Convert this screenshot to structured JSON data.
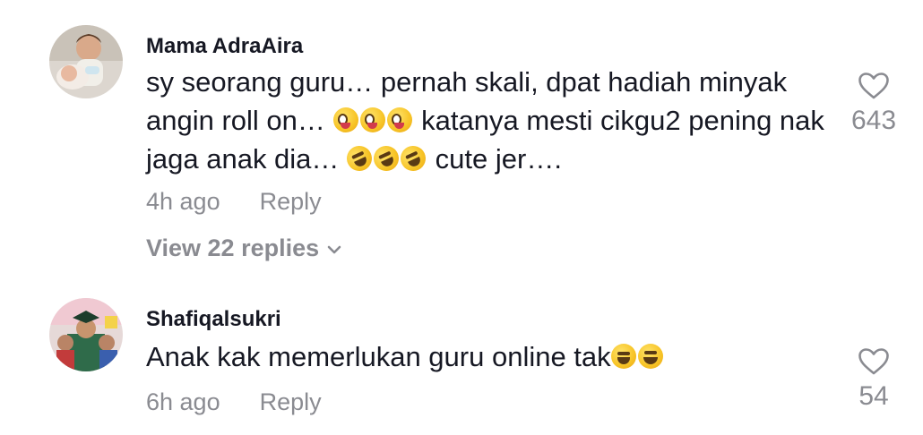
{
  "comments": [
    {
      "username": "Mama AdraAira",
      "avatar_icon": "avatar-photo-child-baby",
      "text_part1": "sy seorang guru… pernah skali, dpat hadiah minyak angin roll on… ",
      "emoji_group1": "zany-face x3",
      "text_part2": " katanya mesti cikgu2 pening nak jaga anak dia… ",
      "emoji_group2": "rofl x3",
      "text_part3": " cute jer….",
      "time": "4h ago",
      "reply_label": "Reply",
      "like_count": "643",
      "view_replies_label": "View 22 replies"
    },
    {
      "username": "Shafiqalsukri",
      "avatar_icon": "avatar-photo-group",
      "text_part1": "Anak kak memerlukan guru online tak",
      "emoji_group1": "joy, grin",
      "time": "6h ago",
      "reply_label": "Reply",
      "like_count": "54"
    }
  ],
  "colors": {
    "primary_text": "#161823",
    "secondary_text": "#8a8b91",
    "background": "#ffffff"
  }
}
